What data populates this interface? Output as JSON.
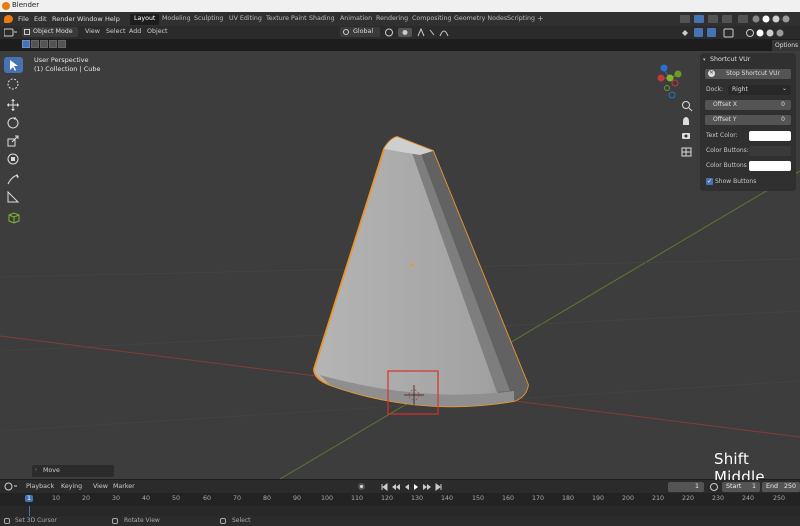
{
  "window": {
    "title": "Blender"
  },
  "menubar": {
    "menus": [
      "File",
      "Edit",
      "Render",
      "Window",
      "Help"
    ],
    "workspaces": [
      "Layout",
      "Modeling",
      "Sculpting",
      "UV Editing",
      "Texture Paint",
      "Shading",
      "Animation",
      "Rendering",
      "Compositing",
      "Geometry Nodes",
      "Scripting"
    ],
    "active_workspace": "Layout",
    "add_tab": "+"
  },
  "header": {
    "mode": "Object Mode",
    "menus": [
      "View",
      "Select",
      "Add",
      "Object"
    ],
    "orientation": "Global",
    "options": "Options"
  },
  "viewport": {
    "perspective": "User Perspective",
    "collection": "(1) Collection | Cube",
    "object_color": "#a9a9a9",
    "outline_color": "#e8962e",
    "highlight_box_color": "#d9322b"
  },
  "npanel": {
    "title": "Shortcut VUr",
    "stop_button": "Stop Shortcut VUr",
    "dock_label": "Dock:",
    "dock_value": "Right",
    "offset_x_label": "Offset X",
    "offset_x_value": "0",
    "offset_y_label": "Offset Y",
    "offset_y_value": "0",
    "text_color_label": "Text Color:",
    "color_buttons_label": "Color Buttons:",
    "color_buttons_a_label": "Color Buttons a...",
    "show_buttons_label": "Show Buttons",
    "show_buttons_checked": true
  },
  "last_operator": "Move",
  "shortcut_display": "Shift Middle",
  "timeline": {
    "menus": [
      "Playback",
      "Keying",
      "View",
      "Marker"
    ],
    "current_frame": "1",
    "start_label": "Start",
    "start_value": "1",
    "end_label": "End",
    "end_value": "250",
    "ticks": [
      "1",
      "10",
      "20",
      "30",
      "40",
      "50",
      "60",
      "70",
      "80",
      "90",
      "100",
      "110",
      "120",
      "130",
      "140",
      "150",
      "160",
      "170",
      "180",
      "190",
      "200",
      "210",
      "220",
      "230",
      "240",
      "250"
    ]
  },
  "statusbar": {
    "items": [
      "Set 3D Cursor",
      "Rotate View",
      "Select"
    ]
  },
  "colors": {
    "accent": "#4772b3",
    "brand": "#e87d0d"
  }
}
